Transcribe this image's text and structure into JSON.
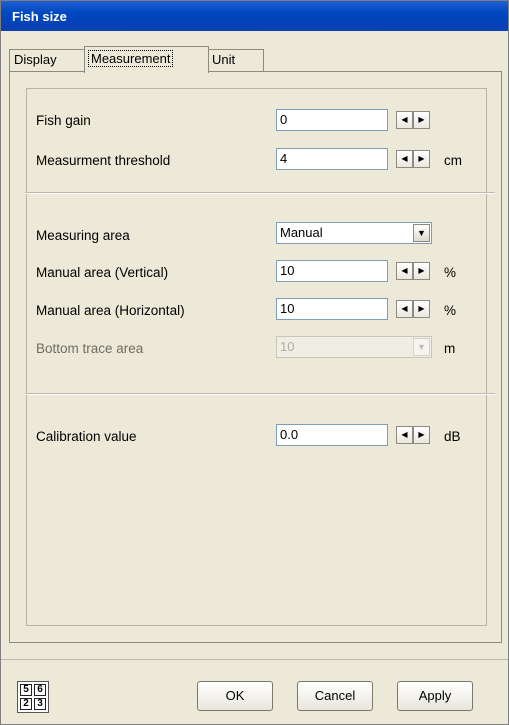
{
  "window": {
    "title": "Fish size"
  },
  "tabs": [
    {
      "label": "Display"
    },
    {
      "label": "Measurement",
      "active": true
    },
    {
      "label": "Unit"
    }
  ],
  "fields": {
    "fish_gain": {
      "label": "Fish gain",
      "value": "0",
      "unit": ""
    },
    "measurement_threshold": {
      "label": "Measurment threshold",
      "value": "4",
      "unit": "cm"
    },
    "measuring_area": {
      "label": "Measuring area",
      "value": "Manual"
    },
    "manual_vertical": {
      "label": "Manual area (Vertical)",
      "value": "10",
      "unit": "%"
    },
    "manual_horizontal": {
      "label": "Manual area (Horizontal)",
      "value": "10",
      "unit": "%"
    },
    "bottom_trace": {
      "label": "Bottom trace area",
      "value": "10",
      "unit": "m",
      "disabled": true
    },
    "calibration": {
      "label": "Calibration value",
      "value": "0.0",
      "unit": "dB"
    }
  },
  "icon_digits": [
    "5",
    "6",
    "2",
    "3"
  ],
  "buttons": {
    "ok": "OK",
    "cancel": "Cancel",
    "apply": "Apply"
  },
  "icons": {
    "spin_left": "left-arrow-icon",
    "spin_right": "right-arrow-icon",
    "dropdown": "chevron-down-icon",
    "numpad": "numpad-icon"
  }
}
